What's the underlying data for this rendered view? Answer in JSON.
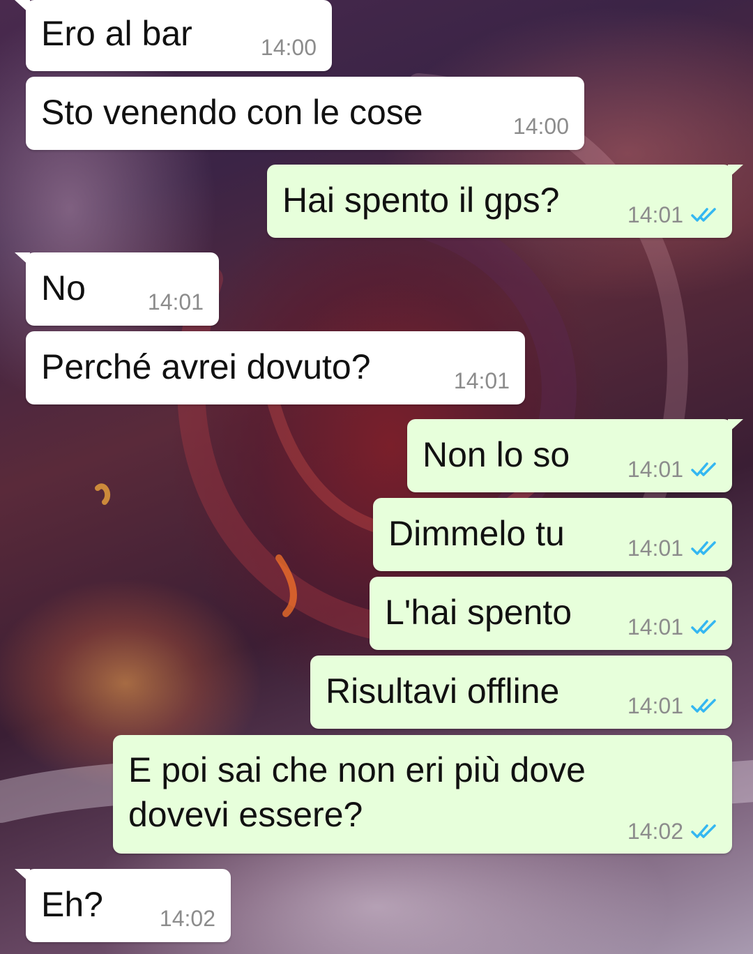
{
  "messages": [
    {
      "text": "Ero al bar",
      "time": "14:00",
      "direction": "incoming"
    },
    {
      "text": "Sto venendo con le cose",
      "time": "14:00",
      "direction": "incoming"
    },
    {
      "text": "Hai spento il gps?",
      "time": "14:01",
      "direction": "outgoing",
      "status": "read"
    },
    {
      "text": "No",
      "time": "14:01",
      "direction": "incoming"
    },
    {
      "text": "Perché avrei dovuto?",
      "time": "14:01",
      "direction": "incoming"
    },
    {
      "text": "Non lo so",
      "time": "14:01",
      "direction": "outgoing",
      "status": "read"
    },
    {
      "text": "Dimmelo tu",
      "time": "14:01",
      "direction": "outgoing",
      "status": "read"
    },
    {
      "text": "L'hai spento",
      "time": "14:01",
      "direction": "outgoing",
      "status": "read"
    },
    {
      "text": "Risultavi offline",
      "time": "14:01",
      "direction": "outgoing",
      "status": "read"
    },
    {
      "text_line1": "E poi sai che non eri più dove",
      "text_line2": "dovevi essere?",
      "time": "14:02",
      "direction": "outgoing",
      "status": "read"
    },
    {
      "text": "Eh?",
      "time": "14:02",
      "direction": "incoming"
    }
  ],
  "colors": {
    "incoming_bubble": "#ffffff",
    "outgoing_bubble": "#e7ffdb",
    "read_ticks": "#34b7f1",
    "timestamp": "#8c8c8c"
  },
  "icons": {
    "read_receipt": "double-check-icon"
  }
}
